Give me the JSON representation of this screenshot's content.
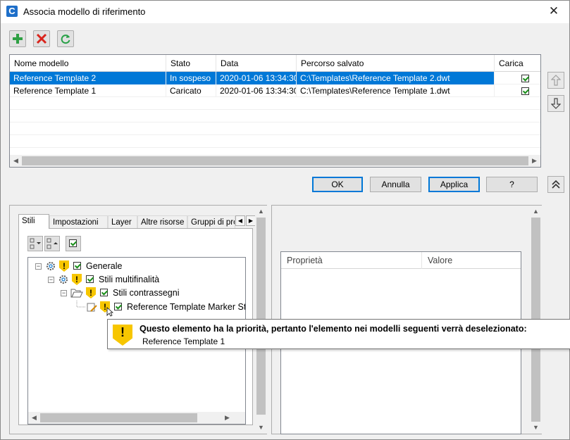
{
  "window": {
    "title": "Associa modello di riferimento",
    "app_icon_letter": "C",
    "close_glyph": "✕"
  },
  "grid": {
    "columns": [
      "Nome modello",
      "Stato",
      "Data",
      "Percorso salvato",
      "Carica"
    ],
    "rows": [
      {
        "name": "Reference Template 2",
        "status": "In sospeso",
        "date": "2020-01-06 13:34:30",
        "path": "C:\\Templates\\Reference Template 2.dwt",
        "load": true,
        "selected": true
      },
      {
        "name": "Reference Template 1",
        "status": "Caricato",
        "date": "2020-01-06 13:34:30",
        "path": "C:\\Templates\\Reference Template 1.dwt",
        "load": true,
        "selected": false
      }
    ]
  },
  "buttons": {
    "ok": "OK",
    "cancel": "Annulla",
    "apply": "Applica",
    "help": "?"
  },
  "tabs": [
    "Stili",
    "Impostazioni",
    "Layer",
    "Altre risorse",
    "Gruppi di pro"
  ],
  "tree": {
    "items": [
      {
        "label": "Generale"
      },
      {
        "label": "Stili multifinalità"
      },
      {
        "label": "Stili contrassegni"
      },
      {
        "label": "Reference Template Marker Style"
      }
    ]
  },
  "properties": {
    "columns": [
      "Proprietà",
      "Valore"
    ]
  },
  "tooltip": {
    "title": "Questo elemento ha la priorità, pertanto l'elemento nei modelli seguenti verrà deselezionato:",
    "body": "Reference Template 1"
  },
  "colors": {
    "selection": "#0078d7",
    "warning": "#f7c600",
    "add_green": "#2ea043",
    "delete_red": "#d9241c",
    "refresh_green": "#27a046"
  }
}
